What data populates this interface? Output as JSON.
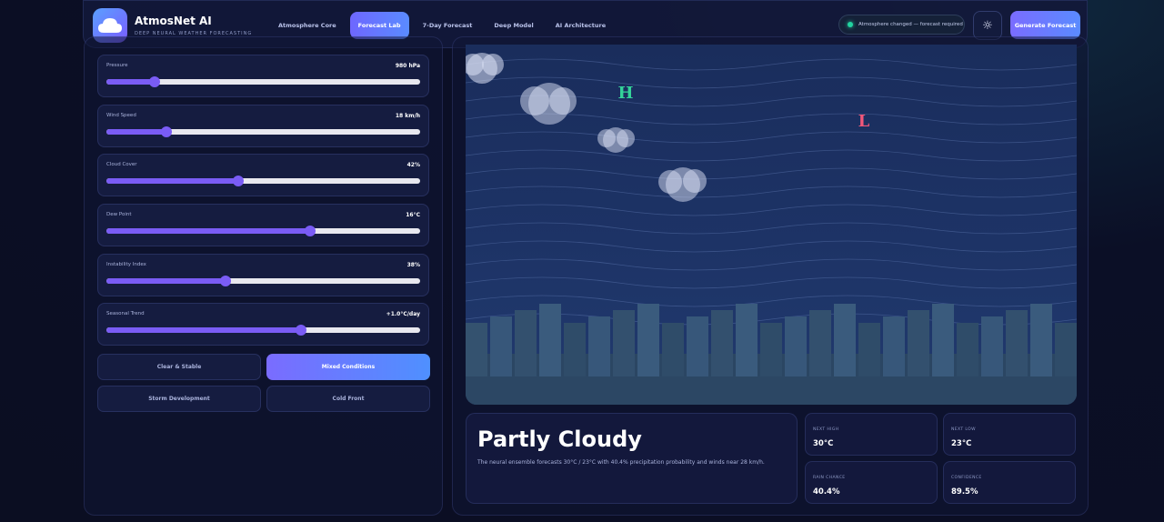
{
  "brand": {
    "title": "AtmosNet AI",
    "subtitle": "DEEP NEURAL WEATHER FORECASTING"
  },
  "nav": {
    "items": [
      {
        "label": "Atmosphere Core",
        "active": false
      },
      {
        "label": "Forecast Lab",
        "active": true
      },
      {
        "label": "7-Day Forecast",
        "active": false
      },
      {
        "label": "Deep Model",
        "active": false
      },
      {
        "label": "AI Architecture",
        "active": false
      }
    ]
  },
  "status": {
    "text": "Atmosphere changed — forecast required",
    "color": "#22d3a0"
  },
  "actions": {
    "theme_icon": "sun-icon",
    "generate_label": "Generate Forecast"
  },
  "sliders": [
    {
      "label": "Pressure",
      "value": "980 hPa",
      "fraction": 0.155
    },
    {
      "label": "Wind Speed",
      "value": "18 km/h",
      "fraction": 0.19
    },
    {
      "label": "Cloud Cover",
      "value": "42%",
      "fraction": 0.42
    },
    {
      "label": "Dew Point",
      "value": "16°C",
      "fraction": 0.65
    },
    {
      "label": "Instability Index",
      "value": "38%",
      "fraction": 0.38
    },
    {
      "label": "Seasonal Trend",
      "value": "+1.0°C/day",
      "fraction": 0.62
    }
  ],
  "presets": [
    {
      "label": "Clear & Stable",
      "active": false
    },
    {
      "label": "Mixed Conditions",
      "active": true
    },
    {
      "label": "Storm Development",
      "active": false
    },
    {
      "label": "Cold Front",
      "active": false
    }
  ],
  "map": {
    "high_label": "H",
    "low_label": "L",
    "high_color": "#34d399",
    "low_color": "#f0577a"
  },
  "forecast": {
    "condition": "Partly Cloudy",
    "description": "The neural ensemble forecasts 30°C / 23°C with 40.4% precipitation probability and winds near 28 km/h."
  },
  "stats": [
    {
      "label": "NEXT HIGH",
      "value": "30°C"
    },
    {
      "label": "NEXT LOW",
      "value": "23°C"
    },
    {
      "label": "RAIN CHANCE",
      "value": "40.4%"
    },
    {
      "label": "CONFIDENCE",
      "value": "89.5%"
    }
  ],
  "colors": {
    "accent": "#7a5cf5",
    "accent_gradient_end": "#4f90ff"
  }
}
